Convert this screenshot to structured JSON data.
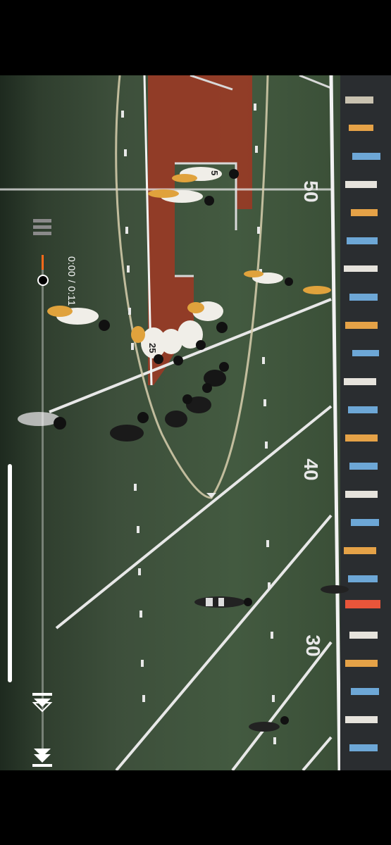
{
  "player": {
    "elapsed": "0:00",
    "duration": "0:11",
    "time_display": "0:00 / 0:11",
    "progress_fraction": 0.03
  },
  "field": {
    "yard_markers": [
      "50",
      "40",
      "30"
    ],
    "player_numbers": [
      "5",
      "25"
    ]
  },
  "controls": {
    "icons": [
      "skip-back-icon",
      "skip-forward-icon",
      "rotate-icon",
      "exit-fullscreen-icon"
    ]
  },
  "colors": {
    "accent": "#ff6a1a",
    "turf": "#3d5239",
    "midfield_logo": "#9a3a25"
  }
}
